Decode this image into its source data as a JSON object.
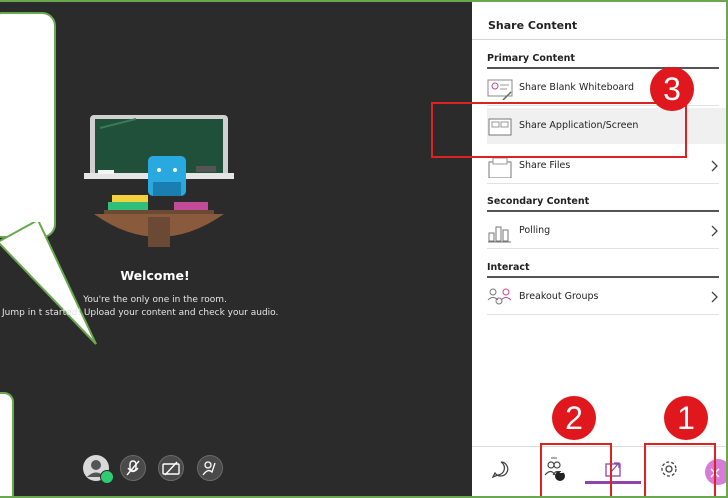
{
  "stage": {
    "welcome_title": "Welcome!",
    "welcome_line1": "You're the only one in the room.",
    "welcome_line2": "Jump in      t started! Upload your content and check your audio."
  },
  "share_panel": {
    "title": "Share Content",
    "primary_section": "Primary Content",
    "primary_items": [
      {
        "label": "Share Blank Whiteboard",
        "icon": "whiteboard-icon",
        "chevron": false
      },
      {
        "label": "Share Application/Screen",
        "icon": "application-screen-icon",
        "chevron": false
      },
      {
        "label": "Share Files",
        "icon": "files-icon",
        "chevron": true
      }
    ],
    "secondary_section": "Secondary Content",
    "secondary_items": [
      {
        "label": "Polling",
        "icon": "polling-icon",
        "chevron": true
      }
    ],
    "interact_section": "Interact",
    "interact_items": [
      {
        "label": "Breakout Groups",
        "icon": "breakout-groups-icon",
        "chevron": true
      }
    ]
  },
  "tabs": {
    "attendees_count": "1"
  },
  "annotations": {
    "badge_1": "1",
    "badge_2": "2",
    "badge_3": "3"
  },
  "colors": {
    "accent": "#8e44ad",
    "annotation_red": "#e0171c",
    "frame_green": "#6aa84f",
    "close_pink": "#d77bd9"
  }
}
